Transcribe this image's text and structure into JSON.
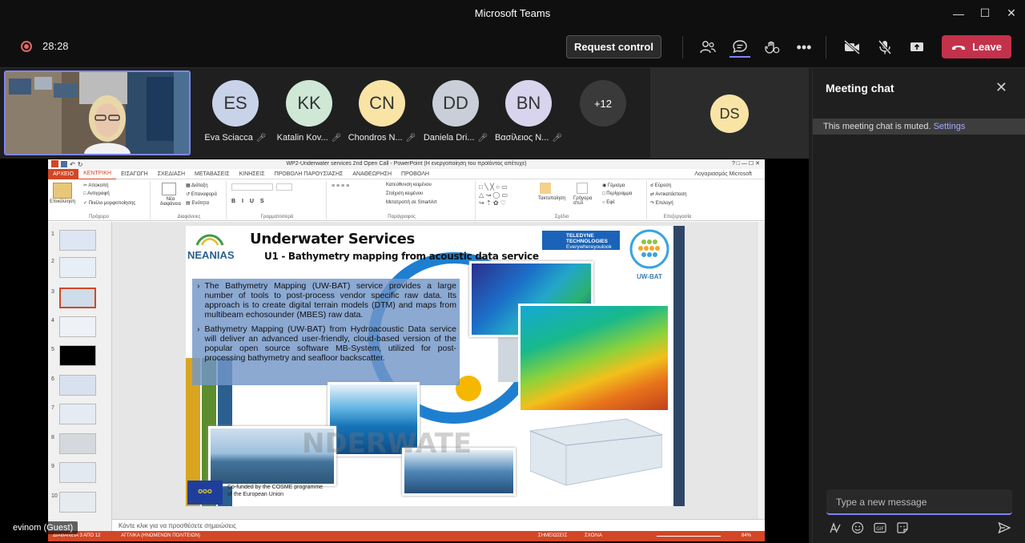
{
  "window": {
    "title": "Microsoft Teams"
  },
  "toolbar": {
    "timer": "28:28",
    "request_control": "Request control",
    "leave": "Leave"
  },
  "participants": [
    {
      "initials": "ES",
      "name": "Eva Sciacca",
      "color": "#c8d3ea"
    },
    {
      "initials": "KK",
      "name": "Katalin Kov...",
      "color": "#cfe8d6"
    },
    {
      "initials": "CN",
      "name": "Chondros N...",
      "color": "#f9e4a6"
    },
    {
      "initials": "DD",
      "name": "Daniela Dri...",
      "color": "#c9ced8"
    },
    {
      "initials": "BN",
      "name": "Βασίλειος Ν...",
      "color": "#d9d4ee"
    }
  ],
  "overflow": {
    "label": "+12"
  },
  "ds_tile": {
    "initials": "DS",
    "color": "#f9e4a6"
  },
  "share": {
    "guest_label": "evinom (Guest)",
    "ppt": {
      "title": "WP2-Underwater services 2nd Open Call - PowerPoint (Η ενεργοποίηση του προϊόντος απέτυχε)",
      "tabs": [
        "ΑΡΧΕΙΟ",
        "ΚΕΝΤΡΙΚΗ",
        "ΕΙΣΑΓΩΓΗ",
        "ΣΧΕΔΙΑΣΗ",
        "ΜΕΤΑΒΑΣΕΙΣ",
        "ΚΙΝΗΣΕΙΣ",
        "ΠΡΟΒΟΛΗ ΠΑΡΟΥΣΙΑΣΗΣ",
        "ΑΝΑΘΕΩΡΗΣΗ",
        "ΠΡΟΒΟΛΗ"
      ],
      "account": "Λογαριασμός Microsoft",
      "ribbon": {
        "paste": "Επικόλληση",
        "cut": "Αποκοπή",
        "copy": "Αντιγραφή",
        "format_painter": "Πινέλο μορφοποίησης",
        "clipboard": "Πρόχειρο",
        "new_slide": "Νέα διαφάνεια",
        "layout": "Διάταξη",
        "reset": "Επαναφορά",
        "section": "Ενότητα",
        "slides": "Διαφάνειες",
        "font": "Γραμματοσειρά",
        "text_direction": "Κατεύθυνση κειμένου",
        "align_text": "Στοίχιση κειμένου",
        "smartart": "Μετατροπή σε SmartArt",
        "paragraph": "Παράγραφος",
        "arrange": "Τακτοποίηση",
        "quick_styles": "Γρήγορα στυλ",
        "fill": "Γέμισμα",
        "outline": "Περίγραμμα",
        "effects": "Εφέ",
        "drawing": "Σχέδιο",
        "find": "Εύρεση",
        "replace": "Αντικατάσταση",
        "select": "Επιλογή",
        "editing": "Επεξεργασία"
      },
      "thumb_numbers": [
        "1",
        "2",
        "3",
        "4",
        "5",
        "6",
        "7",
        "8",
        "9",
        "10"
      ],
      "notes_placeholder": "Κάντε κλικ για να προσθέσετε σημειώσεις",
      "status_left": "ΔΙΑΦΑΝΕΙΑ 3 ΑΠΟ 12",
      "status_lang": "ΑΓΓΛΙΚΑ (ΗΝΩΜΕΝΩΝ ΠΟΛΙΤΕΙΩΝ)",
      "status_notes": "ΣΗΜΕΙΩΣΕΙΣ",
      "status_comments": "ΣΧΟΛΙΑ",
      "zoom": "84%"
    },
    "slide": {
      "logo": "NEANIAS",
      "title": "Underwater Services",
      "subtitle": "U1 - Bathymetry mapping from acoustic data service",
      "teledyne": "TELEDYNE TECHNOLOGIES",
      "teledyne_tag": "Everywhereyoulook",
      "uwbat": "UW-BAT",
      "bullets": [
        "The Bathymetry Mapping (UW-BAT) service provides a large number of tools to post-process vendor specific raw data. Its approach is to create digital terrain models (DTM) and maps from multibeam echosounder (MBES) raw data.",
        "Bathymetry Mapping (UW-BAT) from Hydroacoustic Data service will deliver an advanced user-friendly, cloud-based version of the popular open source software MB-System, utilized for post-processing bathymetry and seafloor backscatter."
      ],
      "bg_word": "NDERWATE",
      "eu_line1": "Co-funded by the COSME programme",
      "eu_line2": "of the European Union"
    }
  },
  "chat": {
    "title": "Meeting chat",
    "muted_text": "This meeting chat is muted.",
    "muted_link": "Settings",
    "input_placeholder": "Type a new message"
  }
}
